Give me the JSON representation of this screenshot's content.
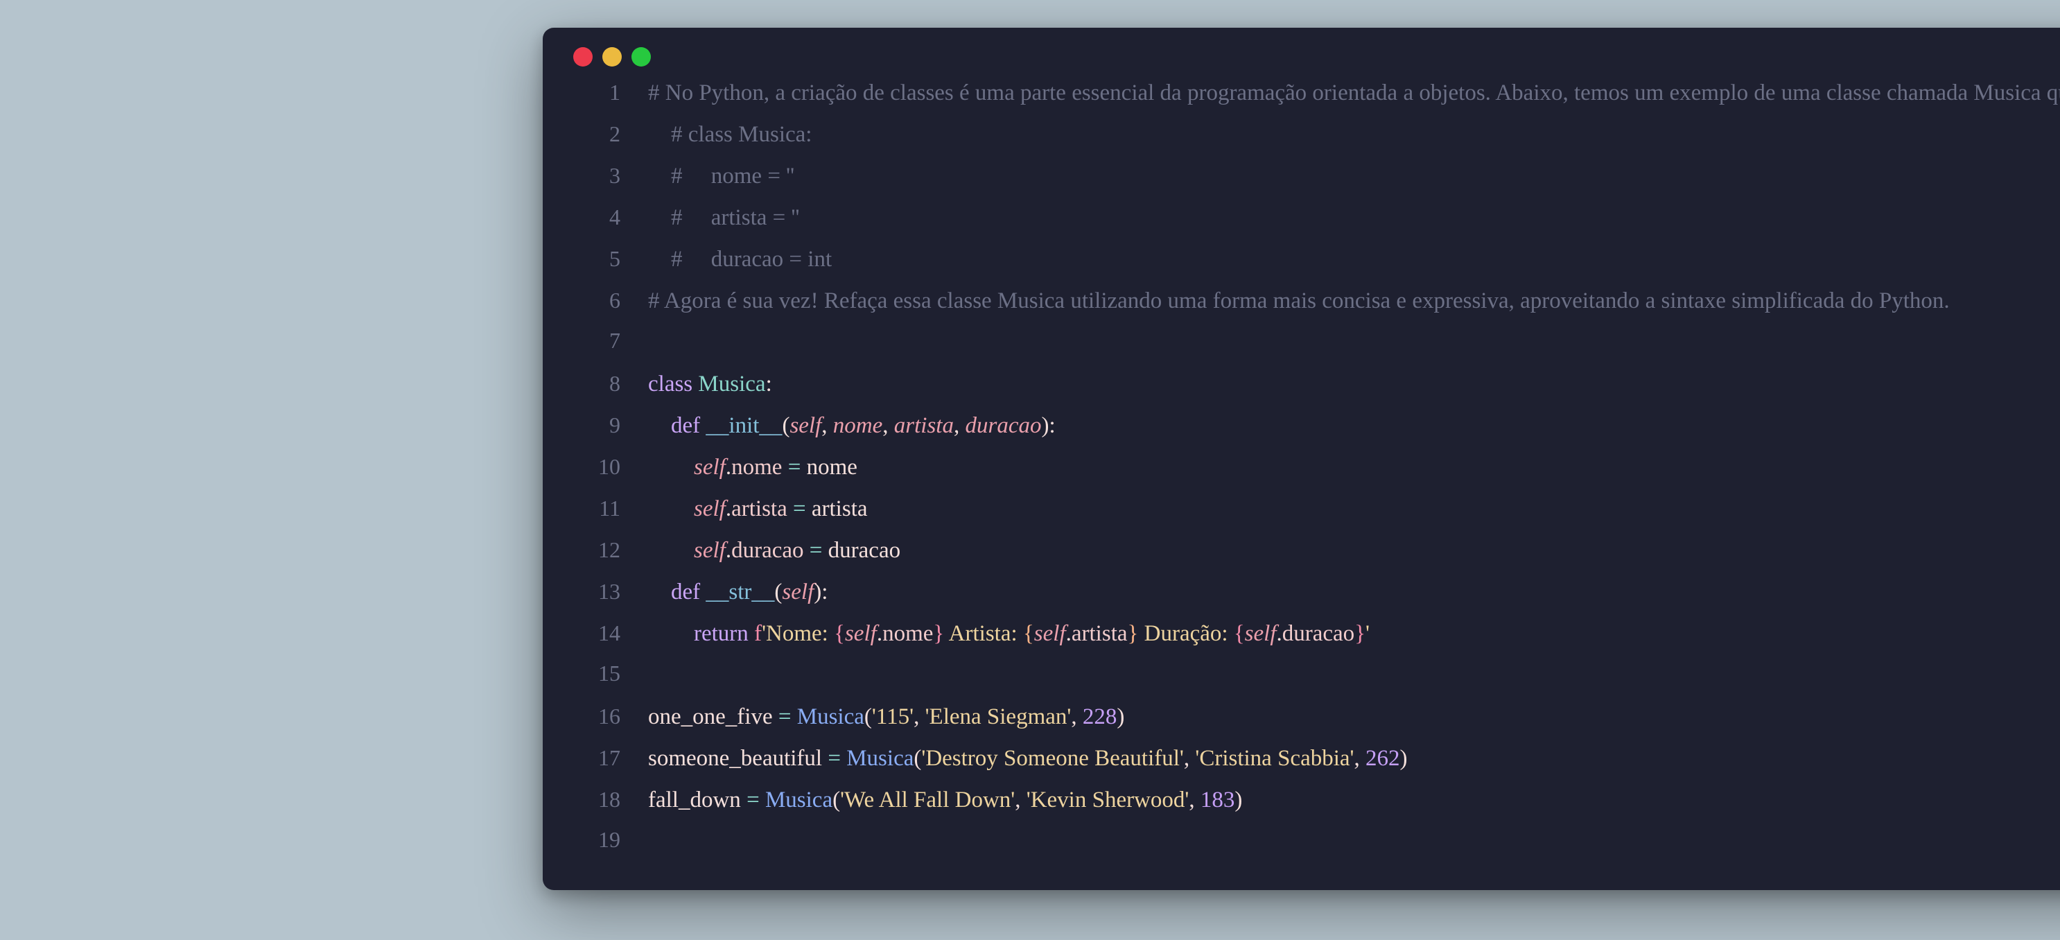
{
  "gutter": {
    "1": "1",
    "2": "2",
    "3": "3",
    "4": "4",
    "5": "5",
    "6": "6",
    "7": "7",
    "8": "8",
    "9": "9",
    "10": "10",
    "11": "11",
    "12": "12",
    "13": "13",
    "14": "14",
    "15": "15",
    "16": "16",
    "17": "17",
    "18": "18",
    "19": "19"
  },
  "lines": {
    "l1": "# No Python, a criação de classes é uma parte essencial da programação orientada a objetos. Abaixo, temos um exemplo de uma classe chamada Musica que representa informações sobre uma música, como nome, artista e duração:",
    "l2": "    # class Musica:",
    "l3": "    #     nome = ''",
    "l4": "    #     artista = ''",
    "l5": "    #     duracao = int",
    "l6": "# Agora é sua vez! Refaça essa classe Musica utilizando uma forma mais concisa e expressiva, aproveitando a sintaxe simplificada do Python.",
    "l7": "",
    "kw_class": "class",
    "cls_name": "Musica",
    "colon": ":",
    "kw_def": "def",
    "magic_init": "__init__",
    "magic_str": "__str__",
    "lparen": "(",
    "rparen": ")",
    "comma": ", ",
    "p_self": "self",
    "p_nome": "nome",
    "p_artista": "artista",
    "p_duracao": "duracao",
    "dot": ".",
    "attr_nome": "nome",
    "attr_artista": "artista",
    "attr_duracao": "duracao",
    "eq": " = ",
    "id_nome": "nome",
    "id_artista": "artista",
    "id_duracao": "duracao",
    "kw_return": "return",
    "f_prefix": " f",
    "s_q": "'",
    "s_seg1": "Nome: ",
    "s_seg2": " Artista: ",
    "s_seg3": " Duração: ",
    "brace_open": "{",
    "brace_close": "}",
    "var_115": "one_one_five",
    "var_sb": "someone_beautiful",
    "var_fd": "fall_down",
    "fn_musica": "Musica",
    "str_115": "'115'",
    "str_elena": "'Elena Siegman'",
    "num_228": "228",
    "str_destroy": "'Destroy Someone Beautiful'",
    "str_cristina": "'Cristina Scabbia'",
    "num_262": "262",
    "str_wafd": "'We All Fall Down'",
    "str_kevin": "'Kevin Sherwood'",
    "num_183": "183",
    "indent1": "    ",
    "indent2": "        "
  }
}
